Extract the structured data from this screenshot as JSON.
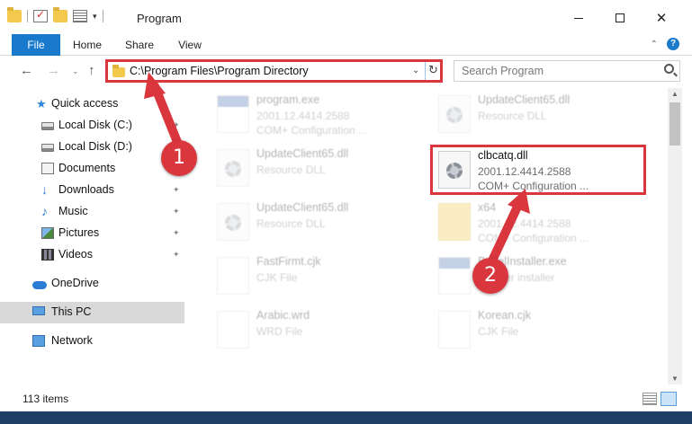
{
  "window": {
    "title": "Program",
    "minimize_glyph": "",
    "maximize_glyph": "",
    "close_glyph": "✕"
  },
  "ribbon": {
    "tabs": [
      {
        "label": "File"
      },
      {
        "label": "Home"
      },
      {
        "label": "Share"
      },
      {
        "label": "View"
      }
    ],
    "collapse_glyph": "⌃",
    "help_glyph": "?"
  },
  "navigation": {
    "back_glyph": "←",
    "forward_glyph": "→",
    "recent_glyph": "⌄",
    "up_glyph": "↑",
    "address": "C:\\Program Files\\Program Directory",
    "address_dropdown_glyph": "⌄",
    "refresh_glyph": "↻",
    "search_placeholder": "Search Program"
  },
  "sidebar": {
    "items": [
      {
        "label": "Quick access",
        "icon": "star-icon",
        "pinned": false
      },
      {
        "label": "Local Disk (C:)",
        "icon": "disk-icon",
        "pinned": true
      },
      {
        "label": "Local Disk (D:)",
        "icon": "disk-icon",
        "pinned": false
      },
      {
        "label": "Documents",
        "icon": "documents-icon",
        "pinned": true
      },
      {
        "label": "Downloads",
        "icon": "downloads-icon",
        "pinned": true
      },
      {
        "label": "Music",
        "icon": "music-icon",
        "pinned": true
      },
      {
        "label": "Pictures",
        "icon": "pictures-icon",
        "pinned": true
      },
      {
        "label": "Videos",
        "icon": "videos-icon",
        "pinned": true
      },
      {
        "label": "OneDrive",
        "icon": "cloud-icon",
        "pinned": false
      },
      {
        "label": "This PC",
        "icon": "pc-icon",
        "pinned": false,
        "selected": true
      },
      {
        "label": "Network",
        "icon": "network-icon",
        "pinned": false
      }
    ],
    "pin_glyph": "📌"
  },
  "files": [
    {
      "name": "program.exe",
      "line1": "2001.12.4414.2588",
      "line2": "COM+ Configuration ...",
      "icon": "exe-icon"
    },
    {
      "name": "UpdateClient65.dll",
      "line1": "Resource DLL",
      "line2": "",
      "icon": "dll-icon"
    },
    {
      "name": "UpdateClient65.dll",
      "line1": "Resource DLL",
      "line2": "",
      "icon": "dll-icon"
    },
    {
      "name": "clbcatq.dll",
      "line1": "2001.12.4414.2588",
      "line2": "COM+ Configuration ...",
      "icon": "gear-dll-icon",
      "highlighted": true
    },
    {
      "name": "UpdateClient65.dll",
      "line1": "Resource DLL",
      "line2": "",
      "icon": "dll-icon"
    },
    {
      "name": "x64",
      "line1": "2001.12.4414.2588",
      "line2": "COM+ Configuration ...",
      "icon": "folder-icon"
    },
    {
      "name": "FastFirmt.cjk",
      "line1": "CJK File",
      "line2": "",
      "icon": "file-icon"
    },
    {
      "name": "BabelInstaller.exe",
      "line1": "updater installer",
      "line2": "",
      "icon": "exe-icon"
    },
    {
      "name": "Arabic.wrd",
      "line1": "WRD File",
      "line2": "",
      "icon": "file-icon"
    },
    {
      "name": "Korean.cjk",
      "line1": "CJK File",
      "line2": "",
      "icon": "file-icon"
    }
  ],
  "status": {
    "item_count": "113 items"
  },
  "annotations": {
    "step1": "1",
    "step2": "2",
    "color": "#d9363e"
  }
}
